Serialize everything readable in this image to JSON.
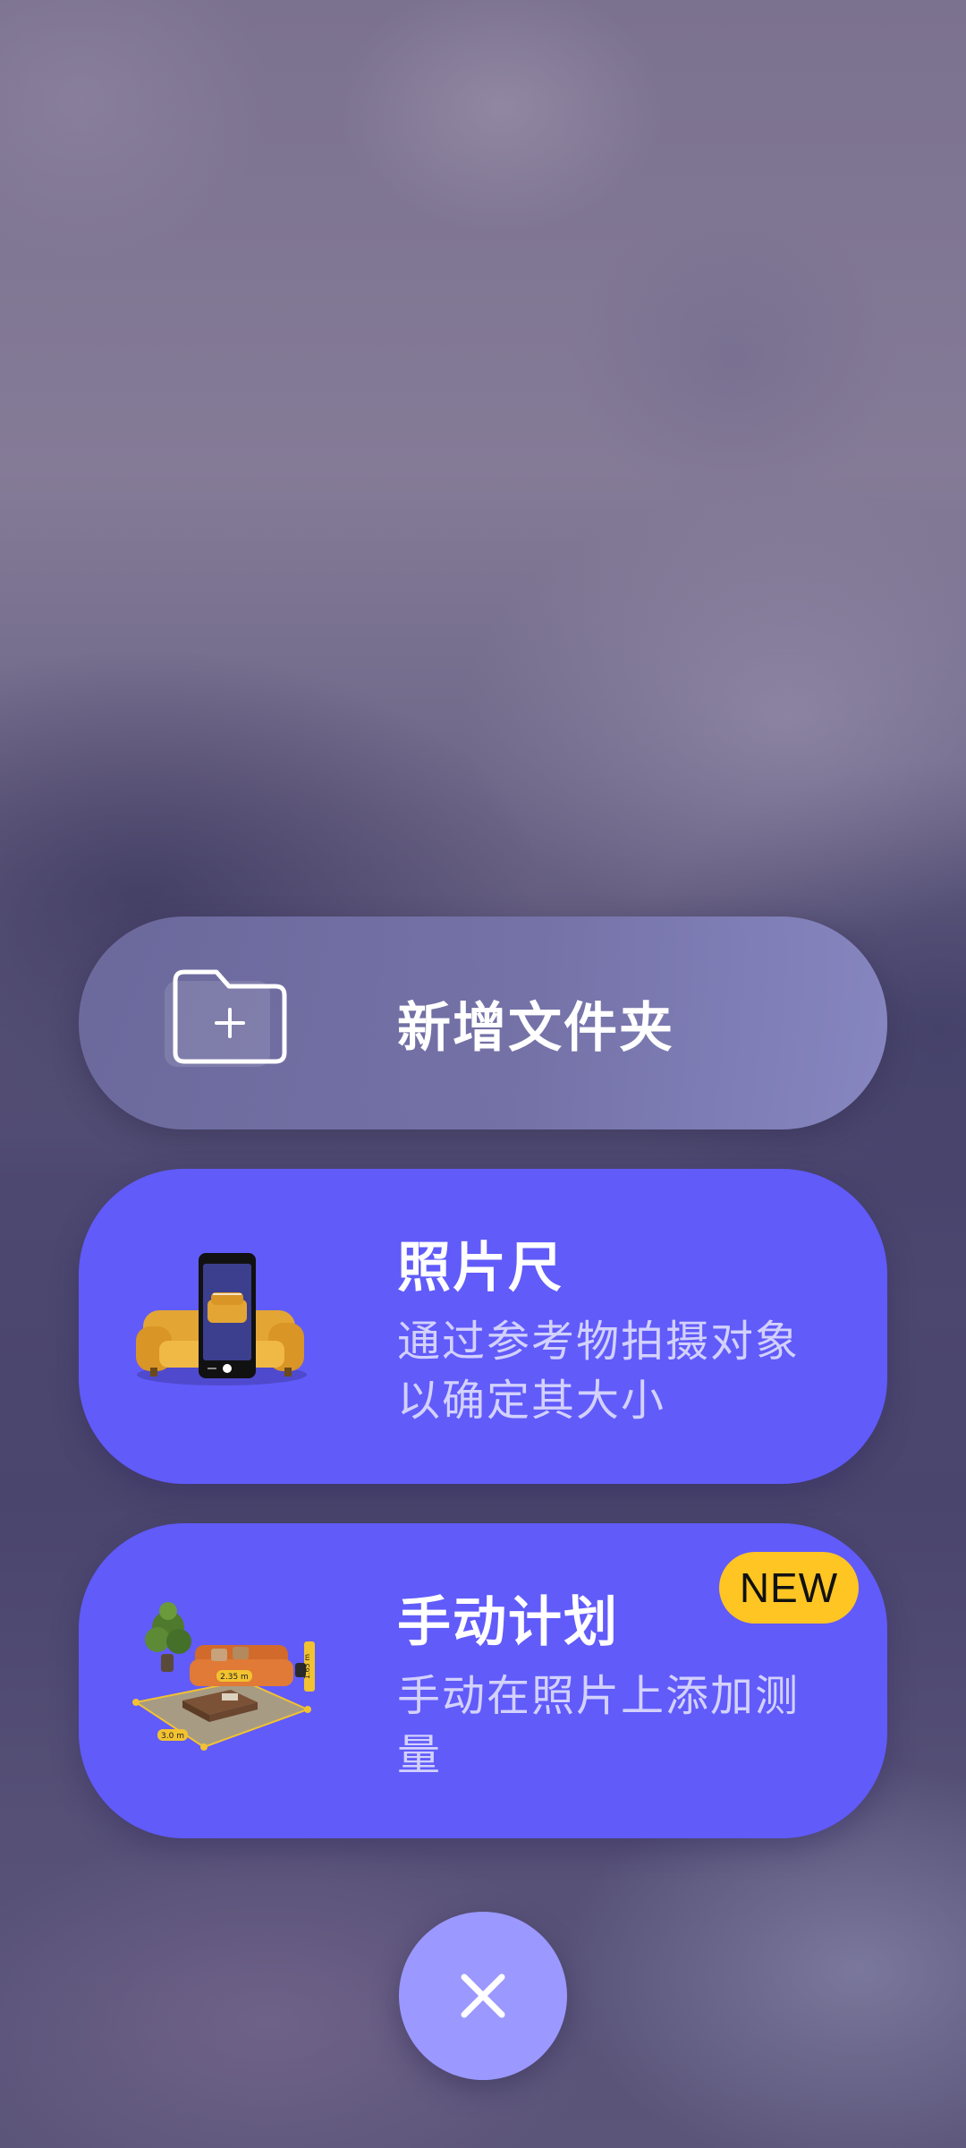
{
  "menu": {
    "new_folder": {
      "title": "新增文件夹",
      "icon": "folder-plus-icon"
    },
    "photo_ruler": {
      "title": "照片尺",
      "description": "通过参考物拍摄对象以确定其大小",
      "icon": "sofa-phone-illustration"
    },
    "manual_plan": {
      "title": "手动计划",
      "description": "手动在照片上添加测量",
      "badge": "NEW",
      "icon": "room-measurement-illustration",
      "illustration_labels": [
        "2.35 m",
        "1.65 m",
        "3.0 m"
      ]
    }
  },
  "close_button": {
    "icon": "close-icon"
  },
  "colors": {
    "card_accent": "#615bfa",
    "badge": "#fec523",
    "close_button": "#9b98ff"
  }
}
